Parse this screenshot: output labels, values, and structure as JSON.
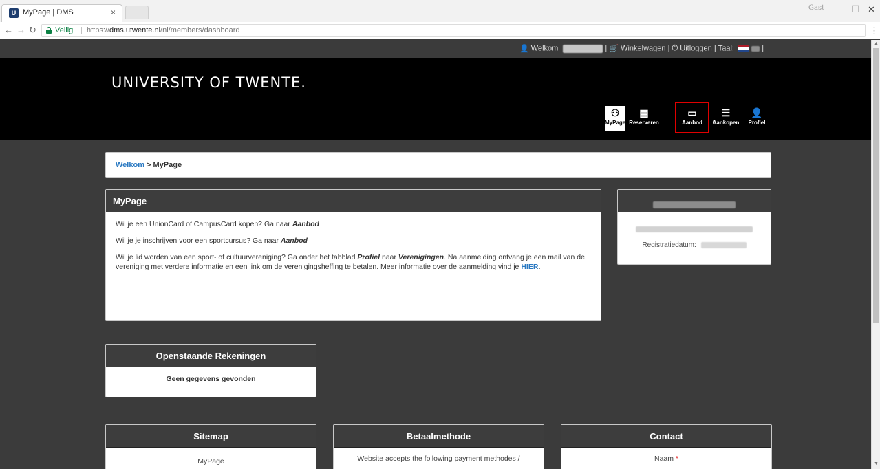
{
  "browser": {
    "tab_title": "MyPage | DMS",
    "tab_close": "×",
    "window_badge": "Gast",
    "secure_label": "Veilig",
    "url_prefix": "https://",
    "url_host": "dms.utwente.nl",
    "url_path": "/nl/members/dashboard"
  },
  "topbar": {
    "welcome": "Welkom",
    "cart": "Winkelwagen",
    "logout": "Uitloggen",
    "language_label": "Taal:",
    "separator": "|"
  },
  "header": {
    "brand": "UNIVERSITY OF TWENTE.",
    "nav": [
      {
        "label": "MyPage",
        "icon": "dashboard-icon",
        "glyph": "⚇"
      },
      {
        "label": "Reserveren",
        "icon": "calendar-icon",
        "glyph": "▦"
      },
      {
        "label": "Aanbod",
        "icon": "card-icon",
        "glyph": "▭"
      },
      {
        "label": "Aankopen",
        "icon": "list-icon",
        "glyph": "☰"
      },
      {
        "label": "Profiel",
        "icon": "user-icon",
        "glyph": "👤"
      }
    ]
  },
  "breadcrumb": {
    "home": "Welkom",
    "separator": " > ",
    "current": "MyPage"
  },
  "mypage": {
    "title": "MyPage",
    "line1_text": "Wil je een UnionCard of CampusCard kopen? Ga naar ",
    "line1_link": "Aanbod",
    "line2_text": "Wil je je inschrijven voor een sportcursus? Ga naar ",
    "line2_link": "Aanbod",
    "line3_a": "Wil je lid worden van een sport- of cultuurvereniging? Ga onder het tabblad ",
    "line3_profiel": "Profiel",
    "line3_b": " naar ",
    "line3_verenigingen": "Verenigingen",
    "line3_c": ". Na aanmelding ontvang je een mail van de vereniging met verdere informatie en een link om de verenigingsheffing te betalen. Meer informatie over de aanmelding vind je ",
    "line3_hier": "HIER",
    "line3_end": "."
  },
  "profile": {
    "registration_label": "Registratiedatum:"
  },
  "invoices": {
    "title": "Openstaande Rekeningen",
    "empty": "Geen gegevens gevonden"
  },
  "footer": {
    "sitemap_title": "Sitemap",
    "sitemap_first": "MyPage",
    "payment_title": "Betaalmethode",
    "payment_text": "Website accepts the following payment methodes /",
    "contact_title": "Contact",
    "contact_name": "Naam",
    "required_mark": "*"
  },
  "colors": {
    "link_blue": "#2a79c2",
    "highlight_red": "#e00000",
    "header_black": "#000000",
    "page_bg": "#3b3b3b"
  }
}
